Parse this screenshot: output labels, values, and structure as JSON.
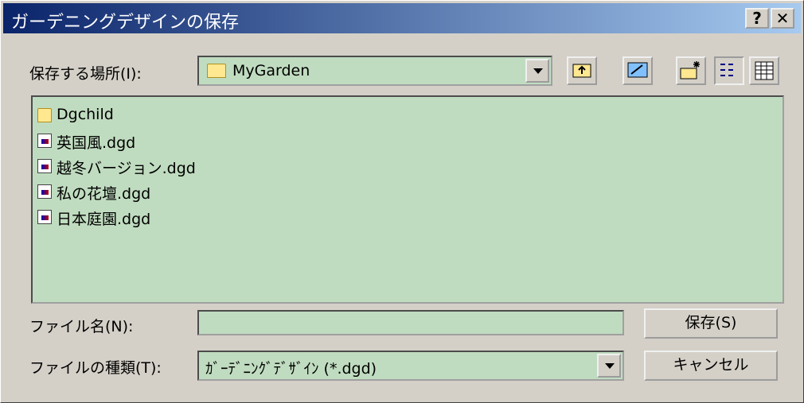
{
  "title": "ガーデニングデザインの保存",
  "titlebar": {
    "help": "?",
    "close": "✕"
  },
  "location": {
    "label": "保存する場所(I):",
    "value": "MyGarden"
  },
  "toolbar": {
    "icons": [
      "up-one-level-icon",
      "desktop-icon",
      "new-folder-icon",
      "list-view-icon",
      "details-view-icon"
    ]
  },
  "files": [
    {
      "name": "Dgchild",
      "type": "folder"
    },
    {
      "name": "英国風.dgd",
      "type": "file"
    },
    {
      "name": "越冬バージョン.dgd",
      "type": "file"
    },
    {
      "name": "私の花壇.dgd",
      "type": "file"
    },
    {
      "name": "日本庭園.dgd",
      "type": "file"
    }
  ],
  "filename": {
    "label": "ファイル名(N):",
    "value": ""
  },
  "filetype": {
    "label": "ファイルの種類(T):",
    "value": "ｶﾞｰﾃﾞﾆﾝｸﾞﾃﾞｻﾞｲﾝ (*.dgd)"
  },
  "buttons": {
    "save": "保存(S)",
    "cancel": "キャンセル"
  },
  "colors": {
    "field_bg": "#c0dcc0",
    "title_start": "#0a246a",
    "title_end": "#a6caf0"
  }
}
